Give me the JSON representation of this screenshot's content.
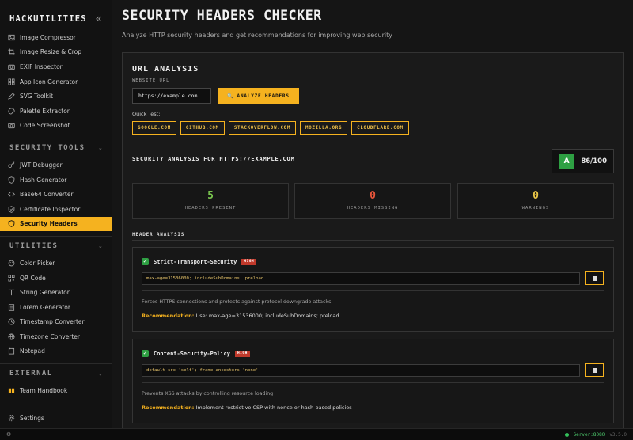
{
  "sidebar": {
    "brand": "HACKUTILITIES",
    "collapse_icon": "«",
    "image_items": [
      {
        "label": "Image Compressor",
        "icon": "image-icon"
      },
      {
        "label": "Image Resize & Crop",
        "icon": "crop-icon"
      },
      {
        "label": "EXIF Inspector",
        "icon": "camera-icon"
      },
      {
        "label": "App Icon Generator",
        "icon": "grid-icon"
      },
      {
        "label": "SVG Toolkit",
        "icon": "pen-icon"
      },
      {
        "label": "Palette Extractor",
        "icon": "palette-icon"
      },
      {
        "label": "Code Screenshot",
        "icon": "camera-icon"
      }
    ],
    "security_section": "SECURITY TOOLS",
    "security_items": [
      {
        "label": "JWT Debugger",
        "icon": "key-icon"
      },
      {
        "label": "Hash Generator",
        "icon": "shield-icon"
      },
      {
        "label": "Base64 Converter",
        "icon": "code-icon"
      },
      {
        "label": "Certificate Inspector",
        "icon": "certificate-icon"
      },
      {
        "label": "Security Headers",
        "icon": "shield-icon",
        "active": true
      }
    ],
    "utilities_section": "UTILITIES",
    "utility_items": [
      {
        "label": "Color Picker",
        "icon": "color-icon"
      },
      {
        "label": "QR Code",
        "icon": "qr-icon"
      },
      {
        "label": "String Generator",
        "icon": "type-icon"
      },
      {
        "label": "Lorem Generator",
        "icon": "doc-icon"
      },
      {
        "label": "Timestamp Converter",
        "icon": "clock-icon"
      },
      {
        "label": "Timezone Converter",
        "icon": "globe-icon"
      },
      {
        "label": "Notepad",
        "icon": "note-icon"
      }
    ],
    "external_section": "EXTERNAL",
    "external_items": [
      {
        "label": "Team Handbook",
        "icon": "book-icon"
      }
    ],
    "settings_label": "Settings"
  },
  "header": {
    "title": "SECURITY HEADERS CHECKER",
    "subtitle": "Analyze HTTP security headers and get recommendations for improving web security"
  },
  "url_analysis": {
    "title": "URL ANALYSIS",
    "label": "WEBSITE URL",
    "url_value": "https://example.com",
    "analyze_label": "ANALYZE HEADERS",
    "analyze_icon": "🔍",
    "quick_test_label": "Quick Test:",
    "quick_tests": [
      "GOOGLE.COM",
      "GITHUB.COM",
      "STACKOVERFLOW.COM",
      "MOZILLA.ORG",
      "CLOUDFLARE.COM"
    ]
  },
  "results": {
    "title": "SECURITY ANALYSIS FOR HTTPS://EXAMPLE.COM",
    "grade": "A",
    "score": "86/100",
    "stats": [
      {
        "value": "5",
        "label": "HEADERS PRESENT",
        "color": "#7ac74f"
      },
      {
        "value": "0",
        "label": "HEADERS MISSING",
        "color": "#e8553a"
      },
      {
        "value": "0",
        "label": "WARNINGS",
        "color": "#e8c547"
      }
    ]
  },
  "header_analysis": {
    "title": "HEADER ANALYSIS",
    "recommendation_key": "Recommendation:",
    "headers": [
      {
        "name": "Strict-Transport-Security",
        "severity": "HIGH",
        "value": "max-age=31536000; includeSubDomains; preload",
        "description": "Forces HTTPS connections and protects against protocol downgrade attacks",
        "recommendation": "Use: max-age=31536000; includeSubDomains; preload"
      },
      {
        "name": "Content-Security-Policy",
        "severity": "HIGH",
        "value": "default-src 'self'; frame-ancestors 'none'",
        "description": "Prevents XSS attacks by controlling resource loading",
        "recommendation": "Implement restrictive CSP with nonce or hash-based policies"
      }
    ]
  },
  "status_bar": {
    "server": "Server:8080",
    "version": "v3.5.0"
  },
  "colors": {
    "accent": "#f5b21f",
    "success": "#2ea043",
    "danger": "#c0392b"
  }
}
